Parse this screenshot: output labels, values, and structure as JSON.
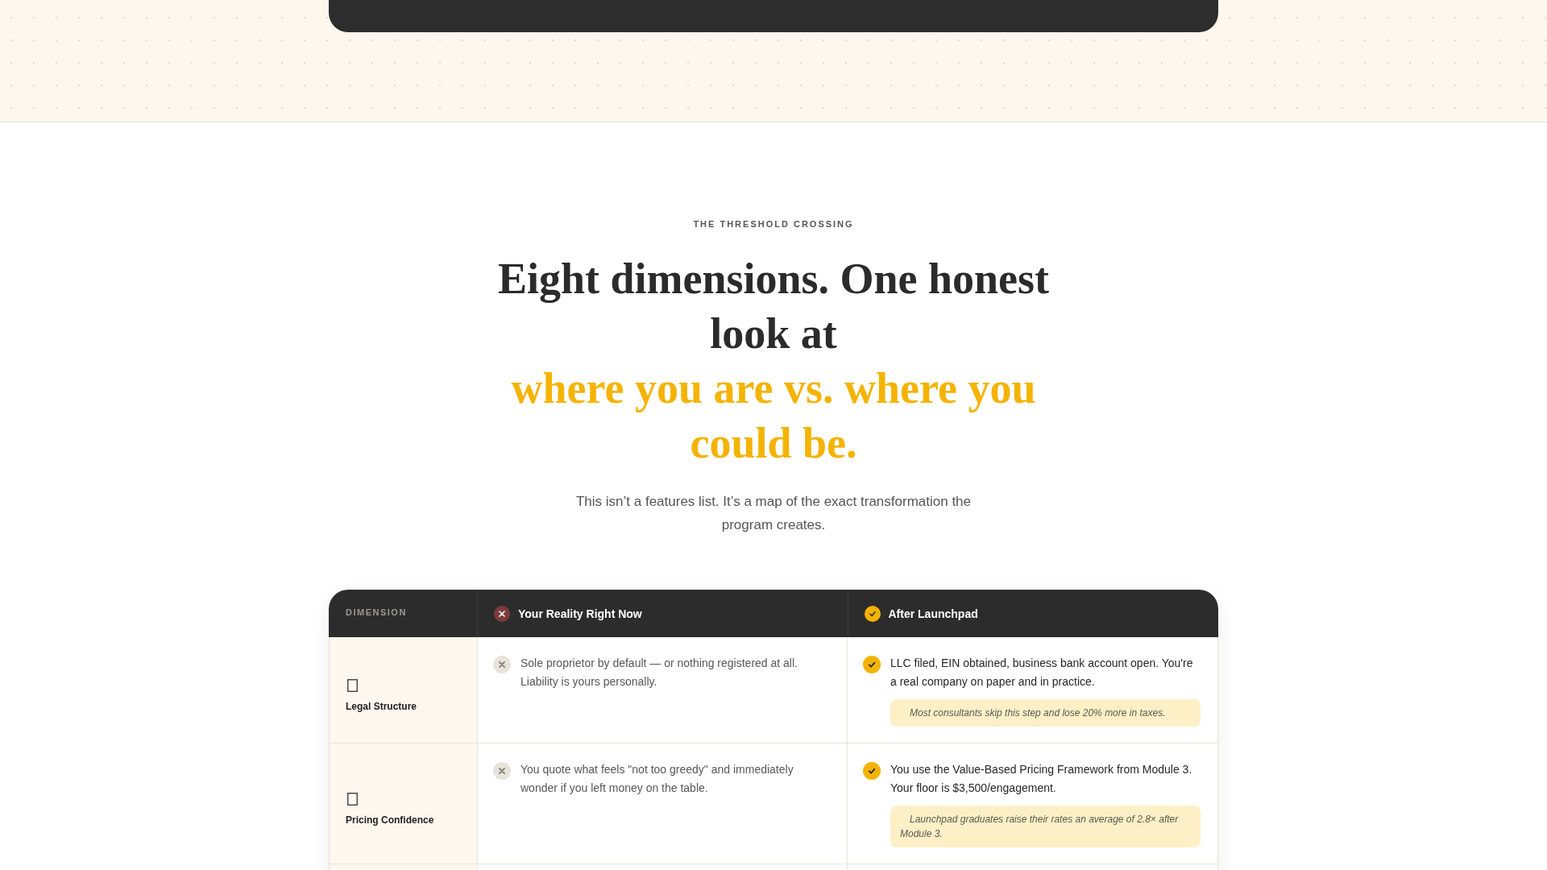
{
  "section": {
    "eyebrow": "THE THRESHOLD CROSSING",
    "heading": "Eight dimensions. One honest look at",
    "heading_highlight": "where you are vs. where you could be.",
    "subtitle": "This isn’t a features list. It’s a map of the exact transformation the program creates."
  },
  "table": {
    "columns": [
      {
        "label": "DIMENSION",
        "kind": "dimension"
      },
      {
        "label": "Your Reality Right Now",
        "kind": "before"
      },
      {
        "label": "After Launchpad",
        "kind": "after"
      }
    ],
    "rows": [
      {
        "dimension": "Legal Structure",
        "now": "Sole proprietor by default — or nothing registered at all. Liability is yours personally.",
        "after": "LLC filed, EIN obtained, business bank account open. You're a real company on paper and in practice.",
        "note": "Most consultants skip this step and lose 20% more in taxes."
      },
      {
        "dimension": "Pricing Confidence",
        "now": "You quote what feels \"not too greedy\" and immediately wonder if you left money on the table.",
        "after": "You use the Value-Based Pricing Framework from Module 3. Your floor is $3,500/engagement.",
        "note": "Launchpad graduates raise their rates an average of 2.8× after Module 3."
      }
    ]
  }
}
